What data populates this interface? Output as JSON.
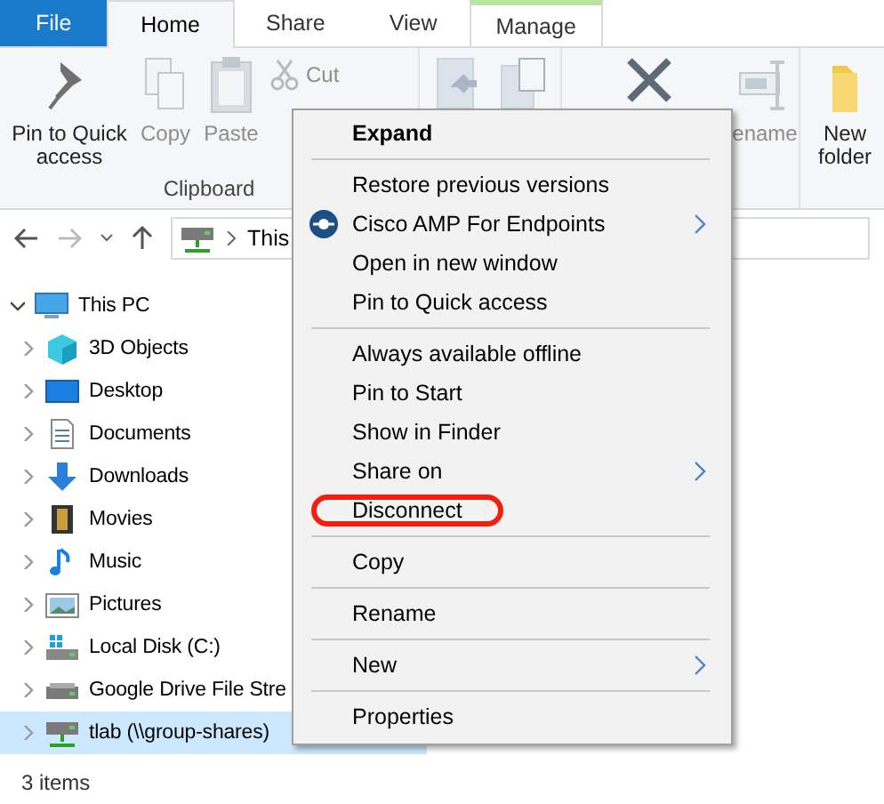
{
  "tabs": [
    {
      "label": "File",
      "kind": "file",
      "selected": false
    },
    {
      "label": "Home",
      "kind": "tab",
      "selected": true
    },
    {
      "label": "Share",
      "kind": "tab",
      "selected": false
    },
    {
      "label": "View",
      "kind": "tab",
      "selected": false
    },
    {
      "label": "Manage",
      "kind": "context",
      "selected": false
    }
  ],
  "ribbon": {
    "groups": [
      {
        "label": "Clipboard",
        "items": [
          {
            "label": "Pin to Quick access",
            "kind": "pin",
            "disabled": false
          },
          {
            "label": "Copy",
            "kind": "copy",
            "disabled": true
          },
          {
            "label": "Paste",
            "kind": "paste",
            "disabled": true
          },
          {
            "label": "Cut",
            "kind": "cut",
            "disabled": true
          }
        ]
      },
      {
        "items": [
          {
            "kind": "move",
            "disabled": true
          },
          {
            "kind": "copyto",
            "disabled": true
          }
        ]
      },
      {
        "items": [
          {
            "kind": "delete",
            "disabled": false
          },
          {
            "label": "ename",
            "kind": "rename",
            "disabled": true
          }
        ]
      },
      {
        "items": [
          {
            "label": "New folder",
            "kind": "folder",
            "disabled": false
          }
        ]
      }
    ]
  },
  "address": {
    "path": "This"
  },
  "tree": [
    {
      "label": "This PC",
      "kind": "pc",
      "expanded": true,
      "selected": false,
      "children": [
        {
          "label": "3D Objects",
          "kind": "cube",
          "expanded": false,
          "selected": false
        },
        {
          "label": "Desktop",
          "kind": "desktop",
          "expanded": false,
          "selected": false
        },
        {
          "label": "Documents",
          "kind": "doc",
          "expanded": false,
          "selected": false
        },
        {
          "label": "Downloads",
          "kind": "download",
          "expanded": false,
          "selected": false
        },
        {
          "label": "Movies",
          "kind": "film",
          "expanded": false,
          "selected": false
        },
        {
          "label": "Music",
          "kind": "music",
          "expanded": false,
          "selected": false
        },
        {
          "label": "Pictures",
          "kind": "pictures",
          "expanded": false,
          "selected": false
        },
        {
          "label": "Local Disk (C:)",
          "kind": "disk",
          "expanded": false,
          "selected": false
        },
        {
          "label": "Google Drive File Stre",
          "kind": "drive",
          "expanded": false,
          "selected": false
        },
        {
          "label": "tlab (\\\\group-shares)",
          "kind": "netdrive",
          "expanded": false,
          "selected": true
        }
      ]
    }
  ],
  "status_bar": {
    "items": "3 items"
  },
  "context_menu": [
    {
      "kind": "item",
      "label": "Expand",
      "default": true
    },
    {
      "kind": "separator"
    },
    {
      "kind": "item",
      "label": "Restore previous versions"
    },
    {
      "kind": "app",
      "label": "Cisco AMP For Endpoints",
      "submenu": true
    },
    {
      "kind": "item",
      "label": "Open in new window"
    },
    {
      "kind": "item",
      "label": "Pin to Quick access"
    },
    {
      "kind": "separator"
    },
    {
      "kind": "item",
      "label": "Always available offline"
    },
    {
      "kind": "item",
      "label": "Pin to Start"
    },
    {
      "kind": "item",
      "label": "Show in Finder"
    },
    {
      "kind": "item",
      "label": "Share on",
      "submenu": true
    },
    {
      "kind": "item",
      "label": "Disconnect",
      "circled": true
    },
    {
      "kind": "separator"
    },
    {
      "kind": "item",
      "label": "Copy"
    },
    {
      "kind": "separator"
    },
    {
      "kind": "item",
      "label": "Rename"
    },
    {
      "kind": "separator"
    },
    {
      "kind": "item",
      "label": "New",
      "submenu": true
    },
    {
      "kind": "separator"
    },
    {
      "kind": "item",
      "label": "Properties"
    }
  ]
}
